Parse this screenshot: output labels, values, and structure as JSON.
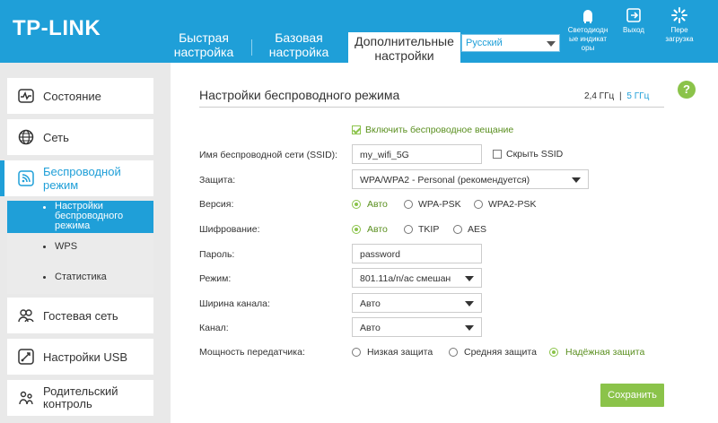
{
  "header": {
    "logo": "TP-LINK",
    "tabs": [
      {
        "line1": "Быстрая",
        "line2": "настройка"
      },
      {
        "line1": "Базовая",
        "line2": "настройка"
      },
      {
        "line1": "Дополнительные",
        "line2": "настройки"
      }
    ],
    "language": "Русский",
    "buttons": {
      "leds": [
        "Светодиодн",
        "ые индикат",
        "оры"
      ],
      "logout": "Выход",
      "reboot": [
        "Пере",
        "загрузка"
      ]
    }
  },
  "sidebar": {
    "items": [
      {
        "label": "Состояние",
        "icon": "status-icon"
      },
      {
        "label": "Сеть",
        "icon": "globe-icon"
      },
      {
        "label": "Беспроводной режим",
        "icon": "wireless-icon"
      },
      {
        "label": "Гостевая сеть",
        "icon": "guest-icon"
      },
      {
        "label": "Настройки USB",
        "icon": "usb-icon"
      },
      {
        "label": "Родительский контроль",
        "icon": "parental-icon"
      }
    ],
    "wireless_sub": [
      {
        "label": "Настройки беспроводного режима"
      },
      {
        "label": "WPS"
      },
      {
        "label": "Статистика"
      }
    ]
  },
  "main": {
    "title": "Настройки беспроводного режима",
    "freq_24": "2,4 ГГц",
    "freq_sep": "|",
    "freq_5": "5 ГГц",
    "enable_broadcast": "Включить беспроводное вещание",
    "ssid_label": "Имя беспроводной сети (SSID):",
    "ssid_value": "my_wifi_5G",
    "hide_ssid": "Скрыть SSID",
    "security_label": "Защита:",
    "security_value": "WPA/WPA2 - Personal (рекомендуется)",
    "version_label": "Версия:",
    "version_options": [
      "Авто",
      "WPA-PSK",
      "WPA2-PSK"
    ],
    "encryption_label": "Шифрование:",
    "encryption_options": [
      "Авто",
      "TKIP",
      "AES"
    ],
    "password_label": "Пароль:",
    "password_value": "password",
    "mode_label": "Режим:",
    "mode_value": "801.11a/n/ac смешан",
    "width_label": "Ширина канала:",
    "width_value": "Авто",
    "channel_label": "Канал:",
    "channel_value": "Авто",
    "power_label": "Мощность передатчика:",
    "power_options": [
      "Низкая защита",
      "Средняя защита",
      "Надёжная защита"
    ],
    "save": "Сохранить",
    "help": "?"
  },
  "colors": {
    "brand": "#1f9fd8",
    "accent_green": "#8bc34a"
  }
}
